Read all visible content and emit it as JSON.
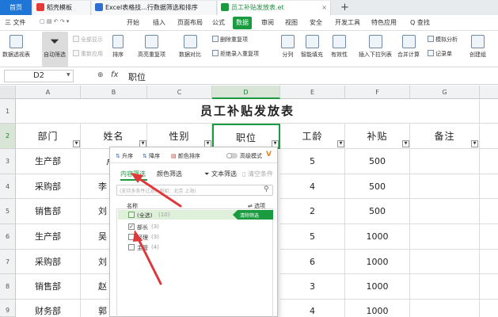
{
  "tabs": {
    "home": "首页",
    "t1": "稻壳模板",
    "t2": "Excel表格技...行数据筛选和排序",
    "t3": "员工补贴发放表.et",
    "plus": "+"
  },
  "menu": {
    "file": "三 文件",
    "items": [
      "开始",
      "插入",
      "页面布局",
      "公式",
      "数据",
      "审阅",
      "视图",
      "安全",
      "开发工具",
      "特色应用"
    ],
    "search": "Q 查找"
  },
  "ribbon": {
    "pivot": "数据透视表",
    "autofilter": "自动筛选",
    "show_all": "全部显示",
    "reapply": "重新应用",
    "sort": "排序",
    "highlight_dup": "高亮重复项",
    "compare": "数据对比",
    "delete_dup": "删除重复项",
    "reject_dup": "拒绝录入重复项",
    "split": "分列",
    "smart_fill": "智能填充",
    "validity": "有效性",
    "dropdown_list": "插入下拉列表",
    "merge_calc": "合并计算",
    "whatif": "模拟分析",
    "record": "记录单",
    "create_group": "创建组"
  },
  "formula_bar": {
    "name_box": "D2",
    "fx": "fx",
    "content": "职位"
  },
  "columns": [
    "A",
    "B",
    "C",
    "D",
    "E",
    "F",
    "G"
  ],
  "rows": [
    "1",
    "2",
    "3",
    "4",
    "5",
    "6",
    "7",
    "8",
    "9"
  ],
  "sheet": {
    "title": "员工补贴发放表",
    "headers": [
      "部门",
      "姓名",
      "性别",
      "职位",
      "工龄",
      "补贴",
      "备注"
    ],
    "dept": [
      "生产部",
      "采购部",
      "销售部",
      "生产部",
      "采购部",
      "销售部",
      "财务部"
    ],
    "name_partial": [
      "卢",
      "李",
      "刘",
      "吴",
      "刘",
      "赵",
      "郭"
    ],
    "seniority": [
      "5",
      "4",
      "2",
      "5",
      "6",
      "3",
      "4"
    ],
    "subsidy": [
      "500",
      "500",
      "500",
      "1000",
      "1000",
      "1000",
      "1000"
    ]
  },
  "filter_panel": {
    "asc": "升序",
    "desc": "降序",
    "color_sort": "颜色排序",
    "advanced": "高级模式",
    "tab_content": "内容筛选",
    "tab_color": "颜色筛选",
    "text_filter": "文本筛选",
    "clear": "清空条件",
    "search_placeholder": "(支持多条件过滤，例如：北京 上海)",
    "name_label": "名称",
    "options_label": "选项",
    "select_all": "(全选)",
    "select_all_count": "(10)",
    "only_filter": "清除筛选",
    "items": [
      {
        "label": "部长",
        "count": "(3)",
        "checked": "✓"
      },
      {
        "label": "经理",
        "count": "(3)",
        "checked": ""
      },
      {
        "label": "主管",
        "count": "(4)",
        "checked": ""
      }
    ]
  },
  "colors": {
    "accent_green": "#1a9b40",
    "home_blue": "#1e77d6",
    "arrow_red": "#e0393b"
  }
}
